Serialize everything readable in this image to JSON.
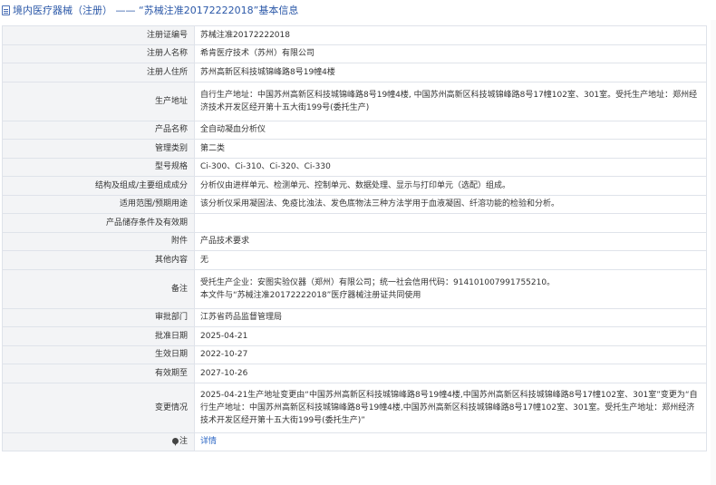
{
  "header": {
    "title": "境内医疗器械（注册） —— “苏械注准20172222018”基本信息",
    "icon": "doc-icon"
  },
  "rows": [
    {
      "label": "注册证编号",
      "value": "苏械注准20172222018"
    },
    {
      "label": "注册人名称",
      "value": "希肯医疗技术（苏州）有限公司"
    },
    {
      "label": "注册人住所",
      "value": "苏州高新区科技城锦峰路8号19幢4楼"
    },
    {
      "label": "生产地址",
      "value": "自行生产地址：中国苏州高新区科技城锦峰路8号19幢4楼, 中国苏州高新区科技城锦峰路8号17幢102室、301室。受托生产地址：郑州经济技术开发区经开第十五大街199号(委托生产)"
    },
    {
      "label": "产品名称",
      "value": "全自动凝血分析仪"
    },
    {
      "label": "管理类别",
      "value": "第二类"
    },
    {
      "label": "型号规格",
      "value": "Ci-300、Ci-310、Ci-320、Ci-330"
    },
    {
      "label": "结构及组成/主要组成成分",
      "value": "分析仪由进样单元、检测单元、控制单元、数据处理、显示与打印单元（选配）组成。"
    },
    {
      "label": "适用范围/预期用途",
      "value": "该分析仪采用凝固法、免疫比浊法、发色底物法三种方法学用于血液凝固、纤溶功能的检验和分析。"
    },
    {
      "label": "产品储存条件及有效期",
      "value": ""
    },
    {
      "label": "附件",
      "value": "产品技术要求"
    },
    {
      "label": "其他内容",
      "value": "无"
    },
    {
      "label": "备注",
      "value_line1": "受托生产企业：安图实验仪器（郑州）有限公司；统一社会信用代码：914101007991755210。",
      "value_line2": "本文件与“苏械注准20172222018”医疗器械注册证共同使用"
    },
    {
      "label": "审批部门",
      "value": "江苏省药品监督管理局"
    },
    {
      "label": "批准日期",
      "value": "2025-04-21"
    },
    {
      "label": "生效日期",
      "value": "2022-10-27"
    },
    {
      "label": "有效期至",
      "value": "2027-10-26"
    },
    {
      "label": "变更情况",
      "value": "2025-04-21生产地址变更由“中国苏州高新区科技城锦峰路8号19幢4楼,中国苏州高新区科技城锦峰路8号17幢102室、301室”变更为“自行生产地址：中国苏州高新区科技城锦峰路8号19幢4楼,中国苏州高新区科技城锦峰路8号17幢102室、301室。受托生产地址：郑州经济技术开发区经开第十五大街199号(委托生产)”"
    },
    {
      "label": "注",
      "icon": "pin-icon",
      "link": "详情"
    }
  ]
}
